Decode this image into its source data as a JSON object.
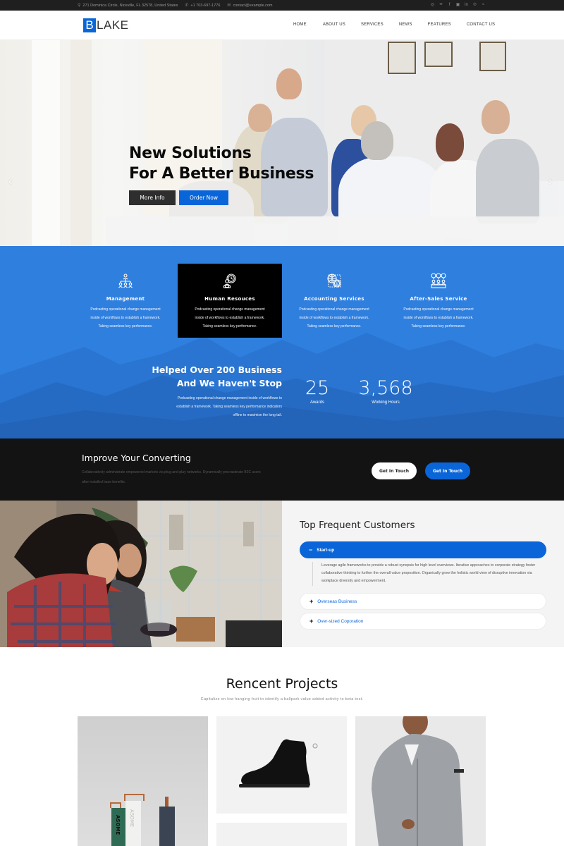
{
  "topbar": {
    "address": "271 Dominica Circle, Niceville, FL 32578, United States",
    "phone": "+1 703-697-1776",
    "email": "contact@example.com",
    "social_icons": [
      "instagram-icon",
      "flickr-icon",
      "facebook-icon",
      "google-plus-icon",
      "linkedin-icon",
      "pinterest-icon",
      "rss-icon"
    ],
    "social_glyphs": [
      "◎",
      "••",
      "f",
      "▣",
      "in",
      "℗",
      "≈"
    ]
  },
  "header": {
    "logo_letter": "B",
    "logo_rest": "LAKE",
    "nav": [
      "HOME",
      "ABOUT US",
      "SERVICES",
      "NEWS",
      "FEATURES",
      "CONTACT US"
    ]
  },
  "hero": {
    "title_line1": "New Solutions",
    "title_line2": "For A Better Business",
    "more_info": "More Info",
    "order_now": "Order Now",
    "prev_arrow": "‹",
    "next_arrow": "›"
  },
  "services": {
    "items": [
      {
        "title": "Management",
        "desc1": "Podcasting operational change management",
        "desc2": "inside of workflows to establish a framework.",
        "desc3": "Taking seamless key performance."
      },
      {
        "title": "Human Resouces",
        "desc1": "Podcasting operational change management",
        "desc2": "inside of workflows to establish a framework.",
        "desc3": "Taking seamless key performance."
      },
      {
        "title": "Accounting Services",
        "desc1": "Podcasting operational change management",
        "desc2": "inside of workflows to establish a framework.",
        "desc3": "Taking seamless key performance."
      },
      {
        "title": "After-Sales Service",
        "desc1": "Podcasting operational change management",
        "desc2": "inside of workflows to establish a framework.",
        "desc3": "Taking seamless key performance."
      }
    ],
    "highlight_color": "#000000",
    "accent": "#2f7fdf"
  },
  "stats": {
    "heading_line1": "Helped Over 200 Business",
    "heading_line2": "And We Haven't Stop",
    "desc_line1": "Podcasting operational change management inside of workflows to",
    "desc_line2": "establish a framework. Taking seamless key performance indicators",
    "desc_line3": "offline to maximise the long tail.",
    "items": [
      {
        "value": "25",
        "label": "Awards"
      },
      {
        "value": "3,568",
        "label": "Working Hours"
      }
    ]
  },
  "cta": {
    "title": "Improve Your Converting",
    "desc_line1": "Collaboratively administrate empowered markets via plug-and-play networks. Dynamically procrastinate B2C users",
    "desc_line2": "after installed base benefits.",
    "button1": "Get In Touch",
    "button2": "Get In Touch"
  },
  "customers": {
    "title": "Top Frequent Customers",
    "accordion": [
      {
        "label": "Start-up",
        "expanded": true,
        "sign": "−",
        "body": "Leverage agile frameworks to provide a robust synopsis for high level overviews. Iterative approaches to corporate strategy foster collaborative thinking to further the overall value proposition. Organically grow the holistic world view of disruptive innovation via workplace diversity and empowerment."
      },
      {
        "label": "Overseas Business",
        "expanded": false,
        "sign": "+"
      },
      {
        "label": "Over-sized Coporation",
        "expanded": false,
        "sign": "+"
      }
    ]
  },
  "projects": {
    "title": "Rencent Projects",
    "subtitle": "Capitalize on low hanging fruit to identify a ballpark value added activity to beta test.",
    "items": [
      {
        "label_text": "ASOME"
      },
      {
        "label_text": ""
      },
      {
        "label_text": ""
      },
      {
        "label_text": ""
      }
    ]
  },
  "colors": {
    "brand": "#0a66d8",
    "services_bg": "#2f7fdf",
    "dark": "#131313"
  }
}
